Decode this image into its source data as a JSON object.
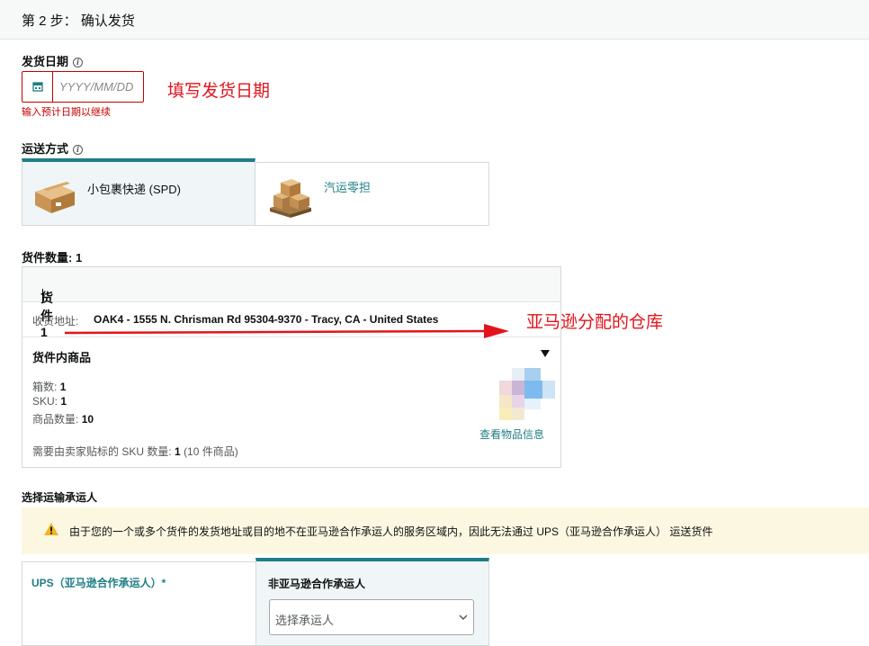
{
  "step": {
    "title": "第 2 步： 确认发货"
  },
  "ship_date": {
    "label": "发货日期",
    "placeholder": "YYYY/MM/DD",
    "error": "输入预计日期以继续",
    "annotation": "填写发货日期"
  },
  "shipping_method": {
    "label": "运送方式",
    "options": [
      {
        "label": "小包裹快递 (SPD)",
        "selected": true
      },
      {
        "label": "汽运零担",
        "selected": false
      }
    ]
  },
  "shipments": {
    "count_label": "货件数量:",
    "count": "1",
    "card": {
      "title": "货件 1",
      "address_label": "收货地址:",
      "address": "OAK4 - 1555 N. Chrisman Rd 95304-9370 - Tracy, CA - United States",
      "annotation": "亚马逊分配的仓库",
      "items_title": "货件内商品",
      "boxes_label": "箱数:",
      "boxes": "1",
      "sku_label": "SKU:",
      "sku": "1",
      "qty_label": "商品数量:",
      "qty": "10",
      "label_sku_text": "需要由卖家贴标的 SKU 数量:",
      "label_sku_count": "1",
      "label_sku_suffix": "(10 件商品)",
      "view_link": "查看物品信息"
    }
  },
  "carrier": {
    "title": "选择运输承运人",
    "warning": "由于您的一个或多个货件的发货地址或目的地不在亚马逊合作承运人的服务区域内，因此无法通过 UPS（亚马逊合作承运人） 运送货件",
    "ups_label": "UPS（亚马逊合作承运人）*",
    "non_partner_label": "非亚马逊合作承运人",
    "select_placeholder": "选择承运人"
  },
  "colors": {
    "teal": "#1f7d85",
    "error": "#c40000",
    "annotation": "#e3131b",
    "warn_bg": "#fcf7e1"
  }
}
